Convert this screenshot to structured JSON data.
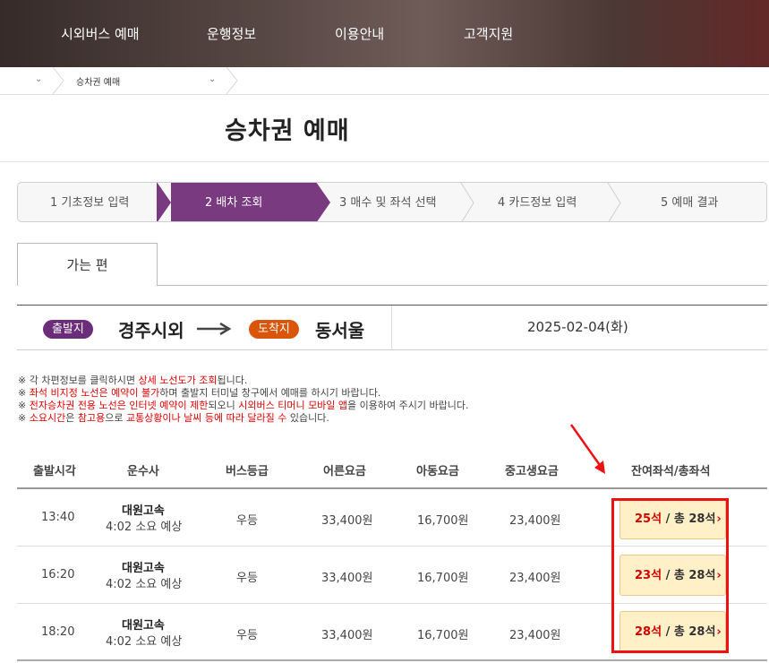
{
  "nav": {
    "items": [
      "시외버스 예매",
      "운행정보",
      "이용안내",
      "고객지원"
    ]
  },
  "breadcrumb": {
    "current": "승차권 예매"
  },
  "page": {
    "title": "승차권 예매"
  },
  "steps": [
    {
      "label": "1 기초정보 입력",
      "active": false
    },
    {
      "label": "2 배차 조회",
      "active": true
    },
    {
      "label": "3 매수 및 좌석 선택",
      "active": false
    },
    {
      "label": "4 카드정보 입력",
      "active": false
    },
    {
      "label": "5 예매 결과",
      "active": false
    }
  ],
  "tab": {
    "label": "가는 편"
  },
  "route": {
    "departure_badge": "출발지",
    "departure": "경주시외",
    "arrival_badge": "도착지",
    "arrival": "동서울",
    "date": "2025-02-04(화)"
  },
  "notices": {
    "line1": {
      "prefix": "※ 각 차편정보를 클릭하시면 ",
      "red": "상세 노선도가 조회",
      "suffix": "됩니다."
    },
    "line2": {
      "prefix": "※ ",
      "red": "좌석 비지정 노선은 예약이 불가",
      "suffix": "하며 출발지 터미널 창구에서 예매를 하시기 바랍니다."
    },
    "line3": {
      "prefix": "※ ",
      "red": "전자승차권 전용 노선은 인터넷 예약이 제한",
      "mid": "되오니 ",
      "red2": "시외버스 티머니 모바일 앱",
      "suffix": "을 이용하여 주시기 바랍니다."
    },
    "line4": {
      "prefix": "※ ",
      "red": "소요시간",
      "mid": "은 ",
      "red2": "참고용",
      "mid2": "으로 ",
      "red3": "교통상황이나 날씨 등에 따라 달라질 수",
      "suffix": " 있습니다."
    }
  },
  "table": {
    "headers": [
      "출발시각",
      "운수사",
      "버스등급",
      "어른요금",
      "아동요금",
      "중고생요금",
      "잔여좌석/총좌석"
    ],
    "rows": [
      {
        "time": "13:40",
        "company": "대원고속",
        "duration": "4:02 소요 예상",
        "grade": "우등",
        "adult": "33,400원",
        "child": "16,700원",
        "teen": "23,400원",
        "remain": "25석",
        "total": " / 총 28석",
        "chevron": "›"
      },
      {
        "time": "16:20",
        "company": "대원고속",
        "duration": "4:02 소요 예상",
        "grade": "우등",
        "adult": "33,400원",
        "child": "16,700원",
        "teen": "23,400원",
        "remain": "23석",
        "total": " / 총 28석",
        "chevron": "›"
      },
      {
        "time": "18:20",
        "company": "대원고속",
        "duration": "4:02 소요 예상",
        "grade": "우등",
        "adult": "33,400원",
        "child": "16,700원",
        "teen": "23,400원",
        "remain": "28석",
        "total": " / 총 28석",
        "chevron": "›"
      }
    ]
  },
  "icons": {
    "breadcrumb_dropdown": "chevron-down-icon",
    "route_arrow": "arrow-right-icon",
    "annotation_arrow": "red-arrow-icon"
  },
  "colors": {
    "step_active": "#7a3a80",
    "departure_badge": "#6b2c7a",
    "arrival_badge": "#d9550a",
    "highlight": "#ee1111",
    "remain_seats": "#d40000"
  }
}
